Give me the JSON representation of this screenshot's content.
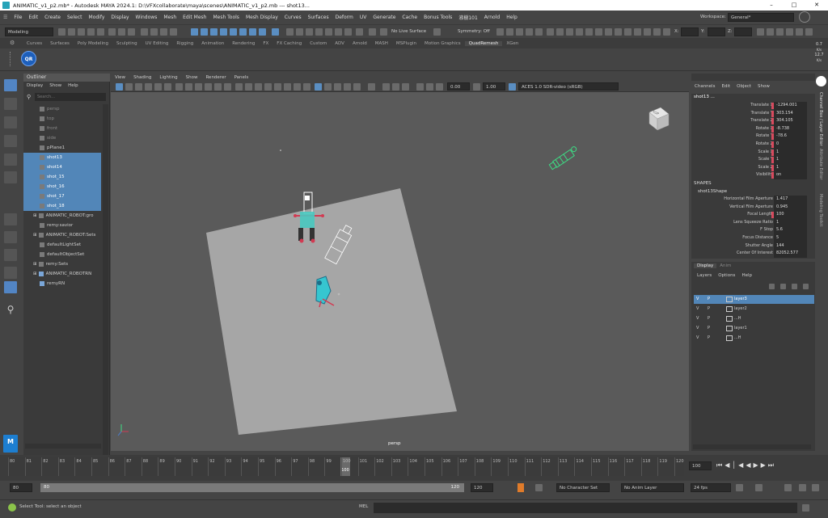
{
  "window": {
    "title": "ANIMATIC_v1_p2.mb* - Autodesk MAYA 2024.1: D:\\VFXcollaborate\\maya\\scenes\\ANIMATIC_v1_p2.mb   ---   shot13..."
  },
  "menubar": [
    "File",
    "Edit",
    "Create",
    "Select",
    "Modify",
    "Display",
    "Windows",
    "Mesh",
    "Edit Mesh",
    "Mesh Tools",
    "Mesh Display",
    "Curves",
    "Surfaces",
    "Deform",
    "UV",
    "Generate",
    "Cache",
    "Bonus Tools",
    "液樹101",
    "Arnold",
    "Help"
  ],
  "status_line": {
    "mode": "Modeling",
    "live_surface": "No Live Surface",
    "symmetry": "Symmetry: Off",
    "workspace_label": "Workspace:",
    "workspace": "General*",
    "x_label": "X:",
    "y_label": "Y:",
    "z_label": "Z:"
  },
  "shelf_tabs": [
    "Curves",
    "Surfaces",
    "Poly Modeling",
    "Sculpting",
    "UV Editing",
    "Rigging",
    "Animation",
    "Rendering",
    "FX",
    "FX Caching",
    "Custom",
    "ADV",
    "Arnold",
    "MASH",
    "MSPlugin",
    "Motion Graphics",
    "QuadRemesh",
    "XGen"
  ],
  "shelf_active": "QuadRemesh",
  "shelf_button": "QR",
  "fps_readout": [
    "0.7",
    "K/s",
    "12.7",
    "K/s"
  ],
  "outliner": {
    "title": "Outliner",
    "menu": [
      "Display",
      "Show",
      "Help"
    ],
    "search_placeholder": "Search...",
    "items": [
      {
        "label": "persp",
        "state": "dim"
      },
      {
        "label": "top",
        "state": "dim"
      },
      {
        "label": "front",
        "state": "dim"
      },
      {
        "label": "side",
        "state": "dim"
      },
      {
        "label": "pPlane1",
        "state": "normal"
      },
      {
        "label": "shot13",
        "state": "sel"
      },
      {
        "label": "shot14",
        "state": "sel"
      },
      {
        "label": "shot_15",
        "state": "sel"
      },
      {
        "label": "shot_16",
        "state": "sel"
      },
      {
        "label": "shot_17",
        "state": "sel"
      },
      {
        "label": "shot_18",
        "state": "sel"
      },
      {
        "label": "ANIMATIC_ROBOT:gro",
        "state": "normal"
      },
      {
        "label": "remy:savior",
        "state": "normal"
      },
      {
        "label": "ANIMATIC_ROBOT:Sets",
        "state": "normal"
      },
      {
        "label": "defaultLightSet",
        "state": "normal"
      },
      {
        "label": "defaultObjectSet",
        "state": "normal"
      },
      {
        "label": "remy:Sets",
        "state": "normal"
      },
      {
        "label": "ANIMATIC_ROBOTRN",
        "state": "normal"
      },
      {
        "label": "remyRN",
        "state": "normal"
      }
    ]
  },
  "viewport": {
    "menu": [
      "View",
      "Shading",
      "Lighting",
      "Show",
      "Renderer",
      "Panels"
    ],
    "exposure": "0.00",
    "gamma": "1.00",
    "color_space": "ACES 1.0 SDR-video (sRGB)",
    "camera": "persp",
    "viewcube_label": "TOP"
  },
  "channel_box": {
    "menu": [
      "Channels",
      "Edit",
      "Object",
      "Show"
    ],
    "object": "shot13 ...",
    "attributes": [
      {
        "label": "Translate X",
        "value": "-1294.001"
      },
      {
        "label": "Translate Y",
        "value": "303.154"
      },
      {
        "label": "Translate Z",
        "value": "304.105"
      },
      {
        "label": "Rotate X",
        "value": "-8.738"
      },
      {
        "label": "Rotate Y",
        "value": "-78.6"
      },
      {
        "label": "Rotate Z",
        "value": "0"
      },
      {
        "label": "Scale X",
        "value": "1"
      },
      {
        "label": "Scale Y",
        "value": "1"
      },
      {
        "label": "Scale Z",
        "value": "1"
      },
      {
        "label": "Visibility",
        "value": "on"
      }
    ],
    "shapes_header": "SHAPES",
    "shape_name": "shot13Shape",
    "shape_attributes": [
      {
        "label": "Horizontal Film Aperture",
        "value": "1.417"
      },
      {
        "label": "Vertical Film Aperture",
        "value": "0.945"
      },
      {
        "label": "Focal Length",
        "value": "100"
      },
      {
        "label": "Lens Squeeze Ratio",
        "value": "1"
      },
      {
        "label": "F Stop",
        "value": "5.6"
      },
      {
        "label": "Focus Distance",
        "value": "5"
      },
      {
        "label": "Shutter Angle",
        "value": "144"
      },
      {
        "label": "Center Of Interest",
        "value": "82052.577"
      }
    ]
  },
  "side_tabs": [
    "Channel Box / Layer Editor",
    "Attribute Editor",
    "Modeling Toolkit"
  ],
  "layer_editor": {
    "tabs": [
      "Display",
      "Anim"
    ],
    "menu": [
      "Layers",
      "Options",
      "Help"
    ],
    "layers": [
      {
        "v": "V",
        "p": "P",
        "name": "layer3",
        "sel": true
      },
      {
        "v": "V",
        "p": "P",
        "name": "layer2",
        "sel": false
      },
      {
        "v": "V",
        "p": "P",
        "name": "...H",
        "sel": false
      },
      {
        "v": "V",
        "p": "P",
        "name": "layer1",
        "sel": false
      },
      {
        "v": "V",
        "p": "P",
        "name": "...H",
        "sel": false
      }
    ]
  },
  "timeline": {
    "ticks": [
      "80",
      "81",
      "82",
      "83",
      "84",
      "85",
      "86",
      "87",
      "88",
      "89",
      "90",
      "91",
      "92",
      "93",
      "94",
      "95",
      "96",
      "97",
      "98",
      "99",
      "100",
      "101",
      "102",
      "103",
      "104",
      "105",
      "106",
      "107",
      "108",
      "109",
      "110",
      "111",
      "112",
      "113",
      "114",
      "115",
      "116",
      "117",
      "118",
      "119",
      "120"
    ],
    "current_frame": "100",
    "current_frame_field": "100",
    "range_start": "80",
    "range_inner_start": "80",
    "range_inner_end": "120",
    "range_end": "120",
    "character_set": "No Character Set",
    "anim_layer": "No Anim Layer",
    "fps": "24 fps"
  },
  "command_line": {
    "language": "MEL",
    "help_text": "Select Tool: select an object"
  },
  "colors": {
    "selection": "#5286b8",
    "keyed_marker": "#d84a5e",
    "camera_wire": "#3ddc84"
  }
}
